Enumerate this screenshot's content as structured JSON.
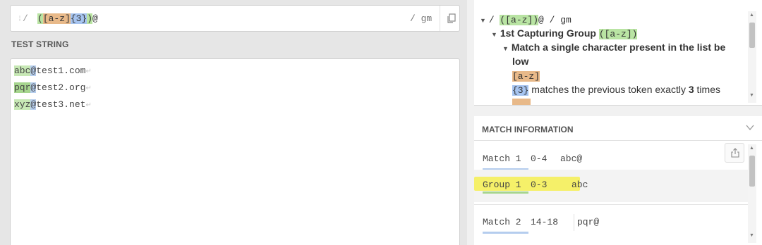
{
  "regex": {
    "delimiter_open": "/",
    "group_open": "(",
    "char_class": "[a-z]",
    "quantifier": "{3}",
    "group_close": ")",
    "literal": "@",
    "flags": "/ gm"
  },
  "test_string": {
    "label": "TEST STRING",
    "lines": [
      {
        "match": "abc",
        "at": "@",
        "rest": "test1.com"
      },
      {
        "match": "pqr",
        "at": "@",
        "rest": "test2.org"
      },
      {
        "match": "xyz",
        "at": "@",
        "rest": "test3.net"
      }
    ],
    "newline_glyph": "↵"
  },
  "explanation": {
    "root_prefix": "/ ",
    "root_group": "([a-z])",
    "root_literal": "@",
    "root_flags": " / gm",
    "group_title": "1st Capturing Group ",
    "group_pattern": "([a-z])",
    "class_title_1": "Match a single character present in the list be",
    "class_title_2": "low",
    "class_token": "[a-z]",
    "quant_token": "{3}",
    "quant_text": " matches the previous token exactly ",
    "quant_count": "3",
    "quant_tail": " times"
  },
  "match_info": {
    "header": "MATCH INFORMATION",
    "rows": [
      {
        "label": "Match 1",
        "range": "0-4",
        "value": "abc@"
      },
      {
        "label": "Group 1",
        "range": "0-3",
        "value": "abc"
      },
      {
        "label": "Match 2",
        "range": "14-18",
        "value": "pqr@"
      }
    ]
  },
  "colors": {
    "group": "#b9e4a3",
    "char_class": "#e8b989",
    "quantifier": "#a6c4f0",
    "highlight": "#f5ef3b"
  }
}
